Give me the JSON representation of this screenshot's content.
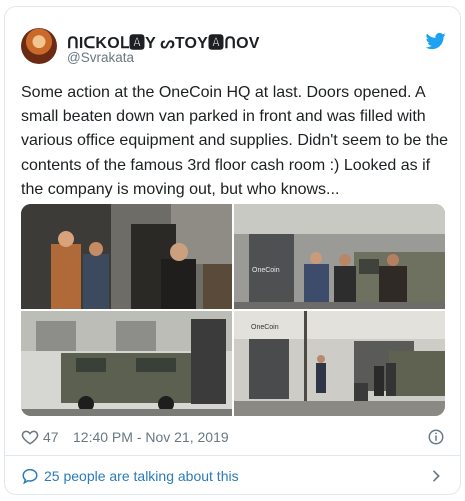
{
  "user": {
    "display_name": "ᑎIᑕKOᒪ🅰Y ᔕTOY🅰ᑎOV",
    "handle": "@Svrakata"
  },
  "tweet": {
    "text": "Some action at the OneCoin HQ at last. Doors opened. A small beaten down van parked in front and was filled with various office equipment and supplies. Didn't seem to be the contents of the famous 3rd floor cash room :) Looked as if the company is moving out, but who knows..."
  },
  "photos": {
    "sign_text": "OneCoin"
  },
  "meta": {
    "like_count": "47",
    "timestamp": "12:40 PM - Nov 21, 2019"
  },
  "footer": {
    "talking_label": "25 people are talking about this"
  },
  "colors": {
    "link": "#2b7bb9",
    "twitter_blue": "#1da1f2",
    "meta_gray": "#697882",
    "border": "#e1e8ed"
  },
  "icons": [
    "twitter-bird-icon",
    "heart-icon",
    "info-icon",
    "speech-bubble-icon",
    "chevron-right-icon"
  ]
}
